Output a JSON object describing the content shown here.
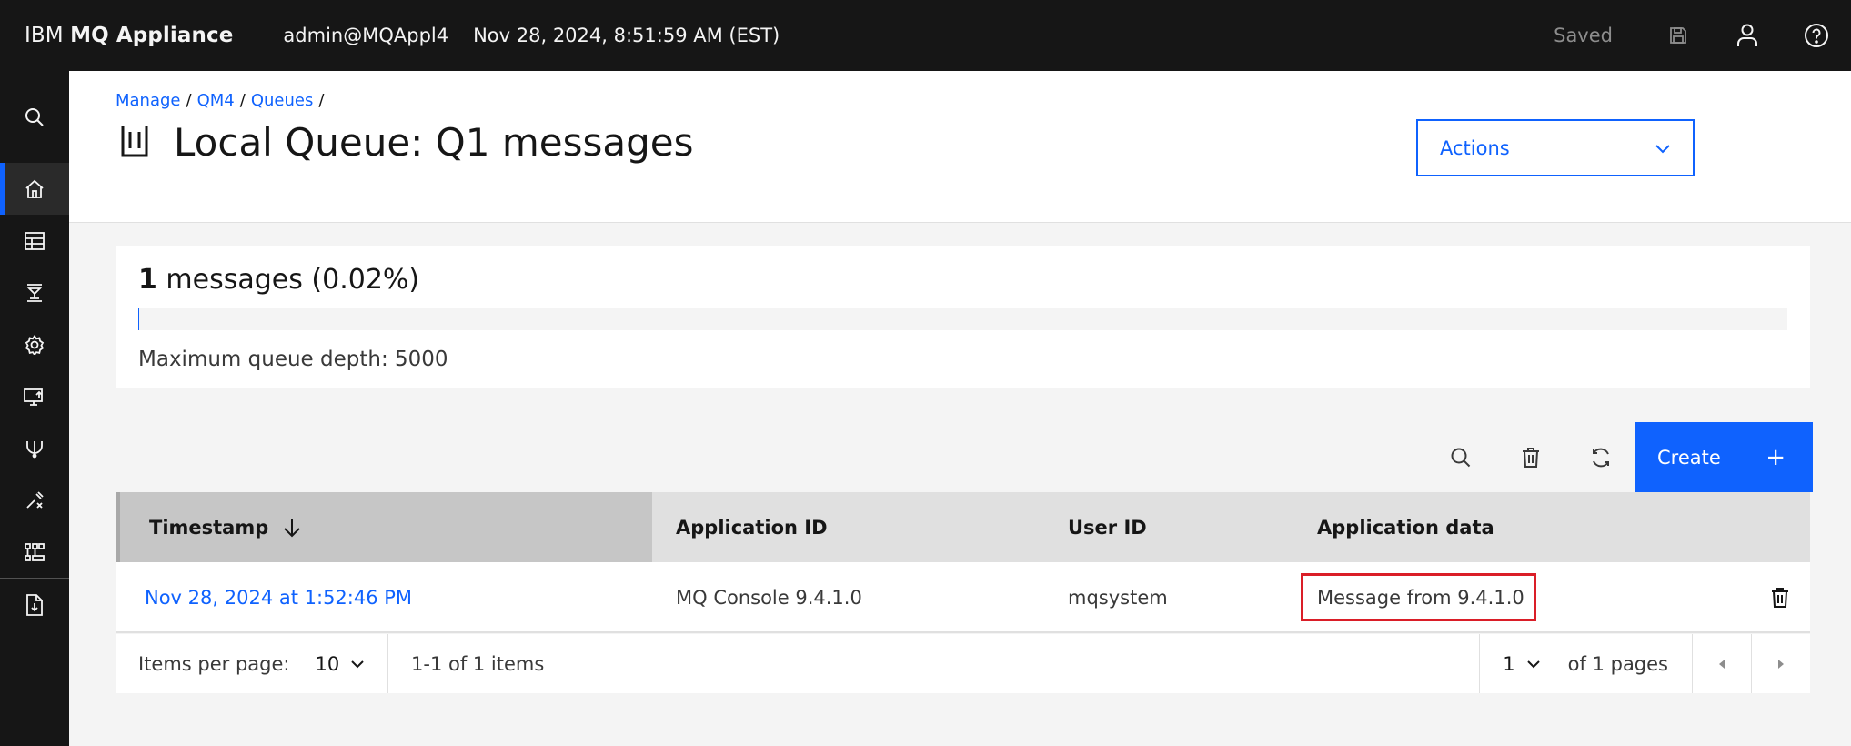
{
  "header": {
    "brand_prefix": "IBM",
    "brand_name": "MQ Appliance",
    "user": "admin@MQAppl4",
    "datetime": "Nov 28, 2024, 8:51:59 AM (EST)",
    "saved_label": "Saved",
    "icons": [
      "save-icon",
      "user-icon",
      "help-icon"
    ]
  },
  "sidebar": {
    "items": [
      {
        "icon": "search-icon",
        "active": false
      },
      {
        "icon": "home-icon",
        "active": true
      },
      {
        "icon": "table-icon",
        "active": false
      },
      {
        "icon": "queue-manager-icon",
        "active": false
      },
      {
        "icon": "settings-icon",
        "active": false
      },
      {
        "icon": "monitor-icon",
        "active": false
      },
      {
        "icon": "network-icon",
        "active": false
      },
      {
        "icon": "tools-icon",
        "active": false
      },
      {
        "icon": "topology-icon",
        "active": false
      },
      {
        "icon": "document-export-icon",
        "active": false
      }
    ]
  },
  "breadcrumb": {
    "items": [
      "Manage",
      "QM4",
      "Queues"
    ],
    "separator": "/"
  },
  "page": {
    "title": "Local Queue: Q1 messages",
    "actions_label": "Actions"
  },
  "depth": {
    "count": "1",
    "count_suffix": "messages (0.02%)",
    "fill_fraction": 0.0002,
    "max_label": "Maximum queue depth: 5000"
  },
  "toolbar": {
    "create_label": "Create",
    "create_plus": "+"
  },
  "table": {
    "columns": [
      "Timestamp",
      "Application ID",
      "User ID",
      "Application data"
    ],
    "sort": {
      "column": "Timestamp",
      "direction": "descending"
    },
    "rows": [
      {
        "timestamp": "Nov 28, 2024 at 1:52:46 PM",
        "application_id": "MQ Console 9.4.1.0",
        "user_id": "mqsystem",
        "application_data": "Message from 9.4.1.0"
      }
    ]
  },
  "pagination": {
    "items_per_page_label": "Items per page:",
    "items_per_page": "10",
    "range": "1-1 of 1 items",
    "current_page": "1",
    "of_pages": "of 1 pages"
  },
  "colors": {
    "accent": "#0f62fe",
    "header_bg": "#161616",
    "highlight": "#da1e28"
  }
}
